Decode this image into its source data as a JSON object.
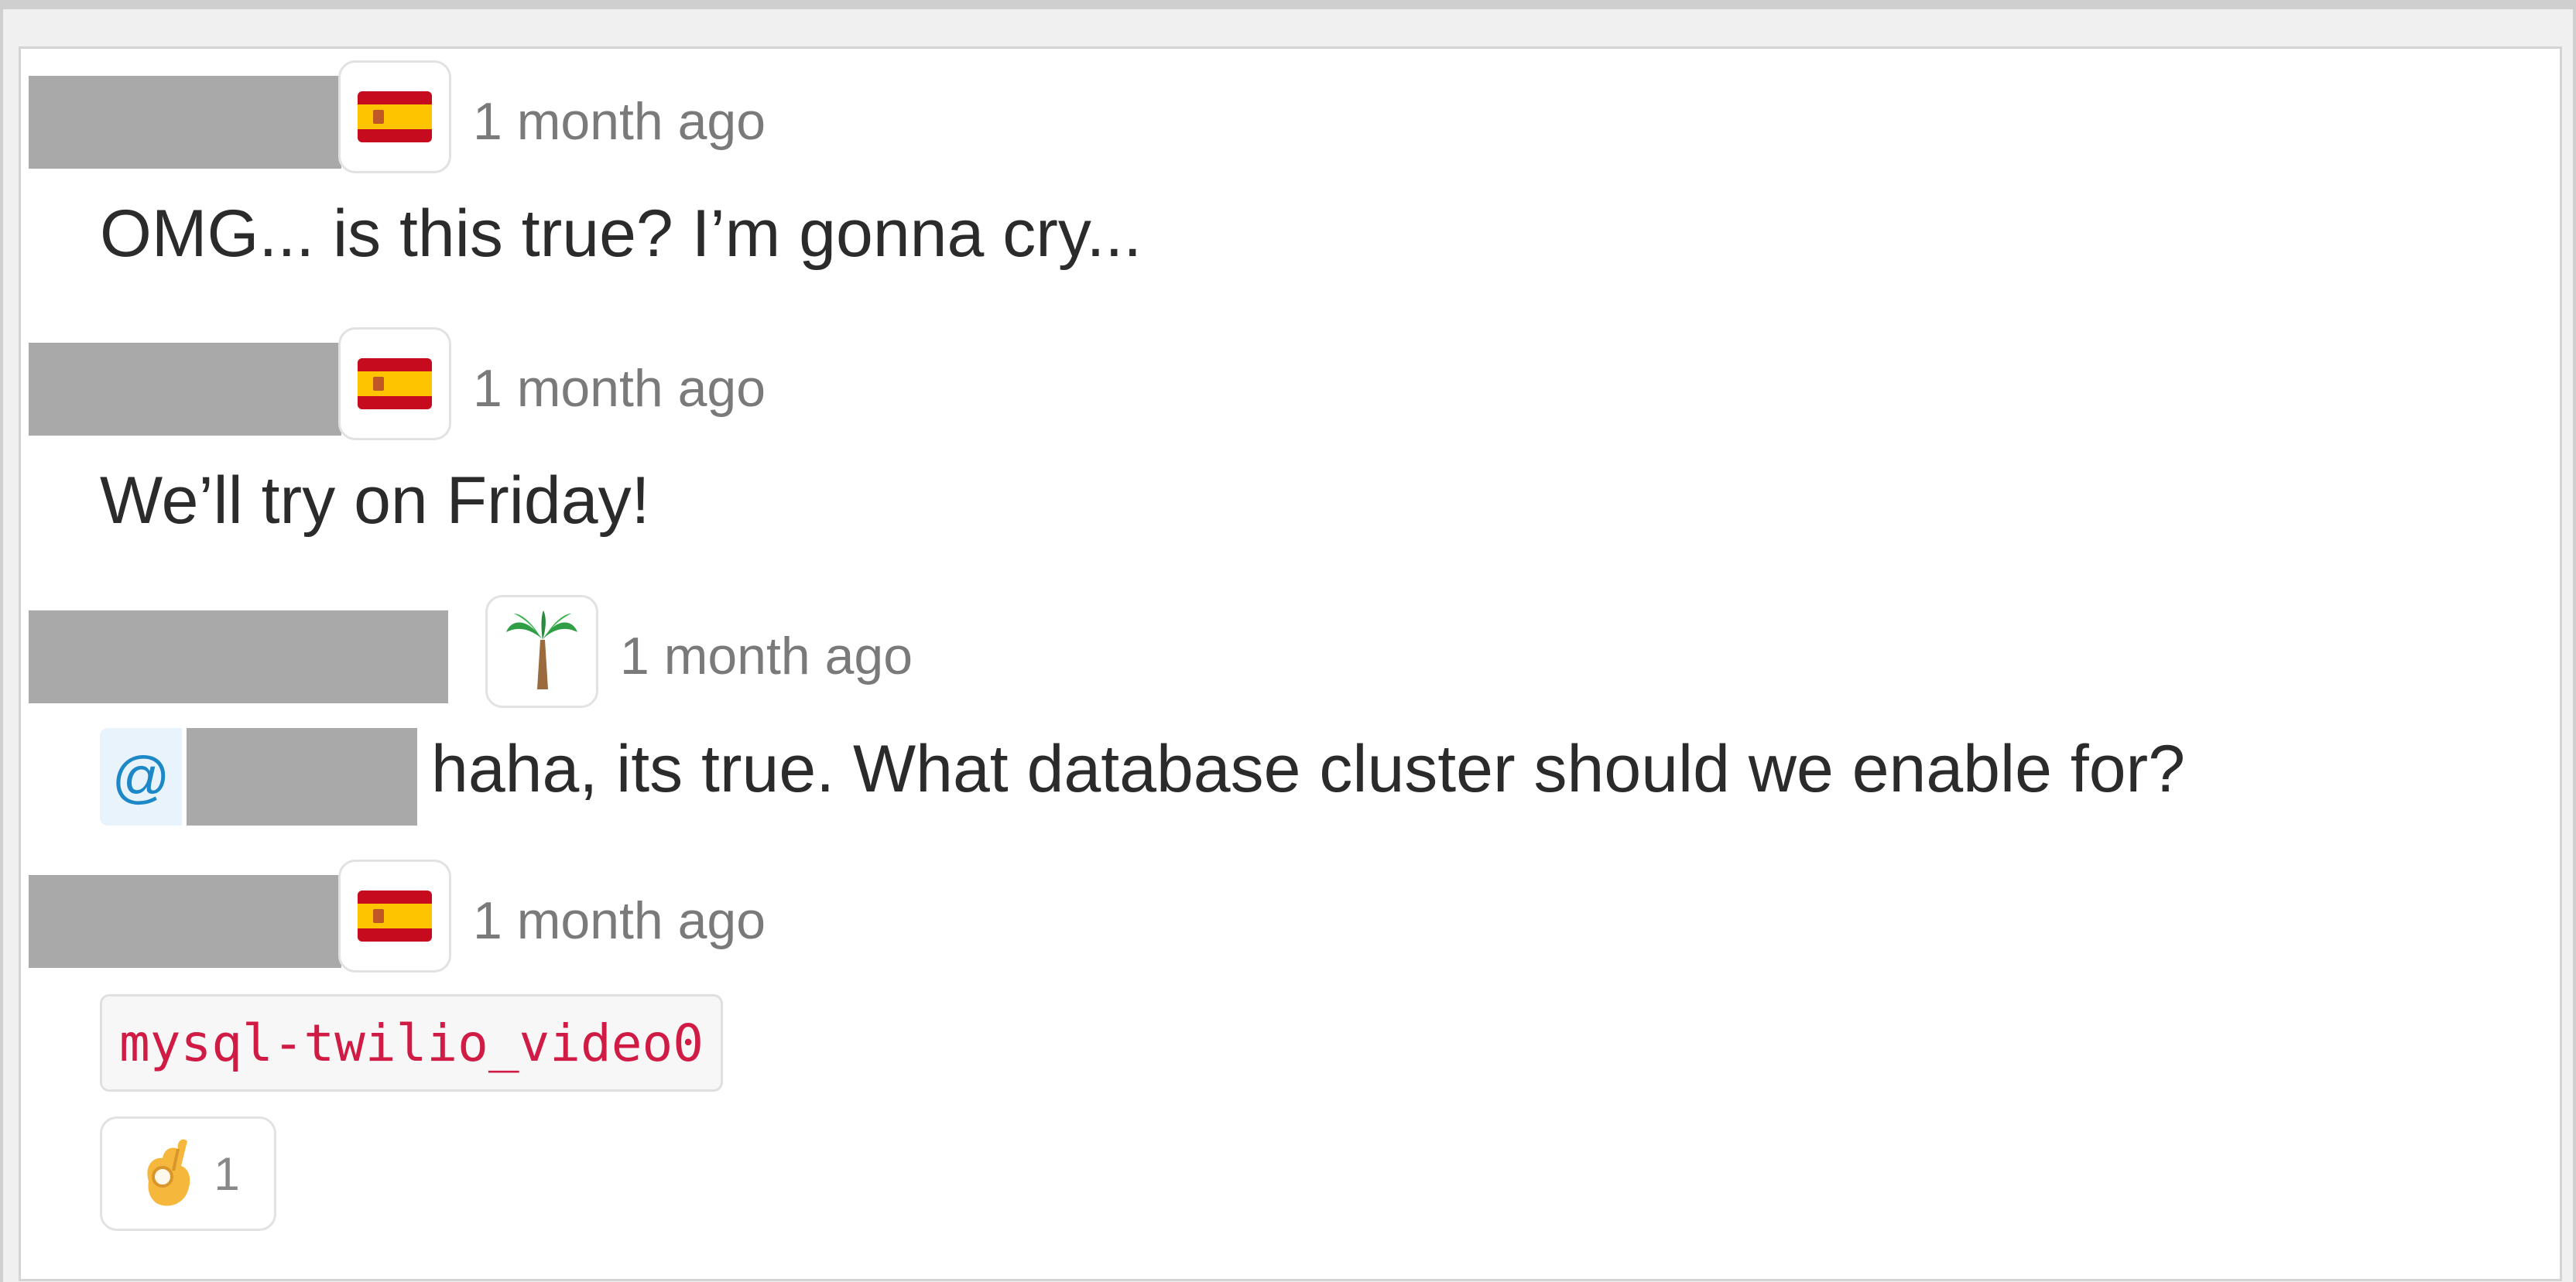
{
  "messages": [
    {
      "status_icon": "spain-flag-icon",
      "timestamp": "1 month ago",
      "text": "OMG... is this true? I’m gonna cry..."
    },
    {
      "status_icon": "spain-flag-icon",
      "timestamp": "1 month ago",
      "text": "We’ll try on Friday!"
    },
    {
      "status_icon": "palm-tree-icon",
      "timestamp": "1 month ago",
      "mention_prefix": "@",
      "text": "haha, its true. What database cluster should we enable for?"
    },
    {
      "status_icon": "spain-flag-icon",
      "timestamp": "1 month ago",
      "code": "mysql-twilio_video0",
      "reaction": {
        "icon": "ok-hand-icon",
        "count": "1"
      }
    }
  ],
  "colors": {
    "mention_text": "#1d88c8",
    "mention_bg": "#e8f3fb",
    "code_text": "#d01c45",
    "redaction": "#a9a9a9"
  }
}
